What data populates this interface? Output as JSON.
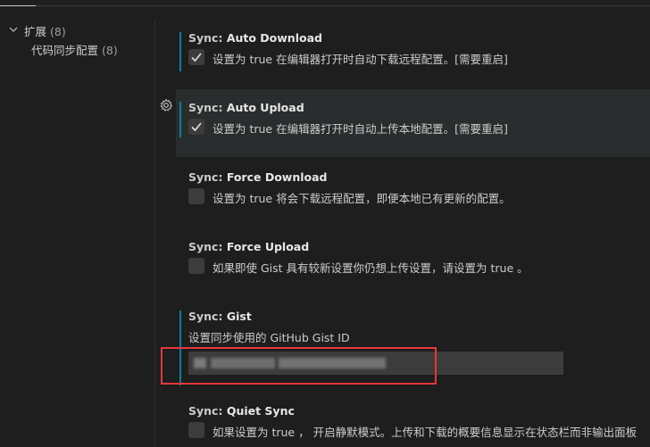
{
  "toc": {
    "group_label": "扩展",
    "group_count": "(8)",
    "child_label": "代码同步配置",
    "child_count": "(8)"
  },
  "settings": [
    {
      "category": "Sync: ",
      "name": "Auto Download",
      "description": "设置为 true 在编辑器打开时自动下载远程配置。[需要重启]",
      "checked": true
    },
    {
      "category": "Sync: ",
      "name": "Auto Upload",
      "description": "设置为 true 在编辑器打开时自动上传本地配置。[需要重启]",
      "checked": true
    },
    {
      "category": "Sync: ",
      "name": "Force Download",
      "description": "设置为 true 将会下载远程配置，即便本地已有更新的配置。",
      "checked": false
    },
    {
      "category": "Sync: ",
      "name": "Force Upload",
      "description": "如果即使 Gist 具有较新设置你仍想上传设置，请设置为 true 。",
      "checked": false
    },
    {
      "category": "Sync: ",
      "name": "Gist",
      "description": "设置同步使用的 GitHub Gist ID",
      "value": ""
    },
    {
      "category": "Sync: ",
      "name": "Quiet Sync",
      "description": "如果设置为 true ， 开启静默模式。上传和下载的概要信息显示在状态栏而非输出面板",
      "checked": false
    }
  ],
  "colors": {
    "modified_indicator": "#0c7d9d",
    "highlight_box": "#e5383b"
  },
  "icons": {
    "settings_gear": "gear-icon",
    "toc_chevron": "chevron-down-icon"
  }
}
